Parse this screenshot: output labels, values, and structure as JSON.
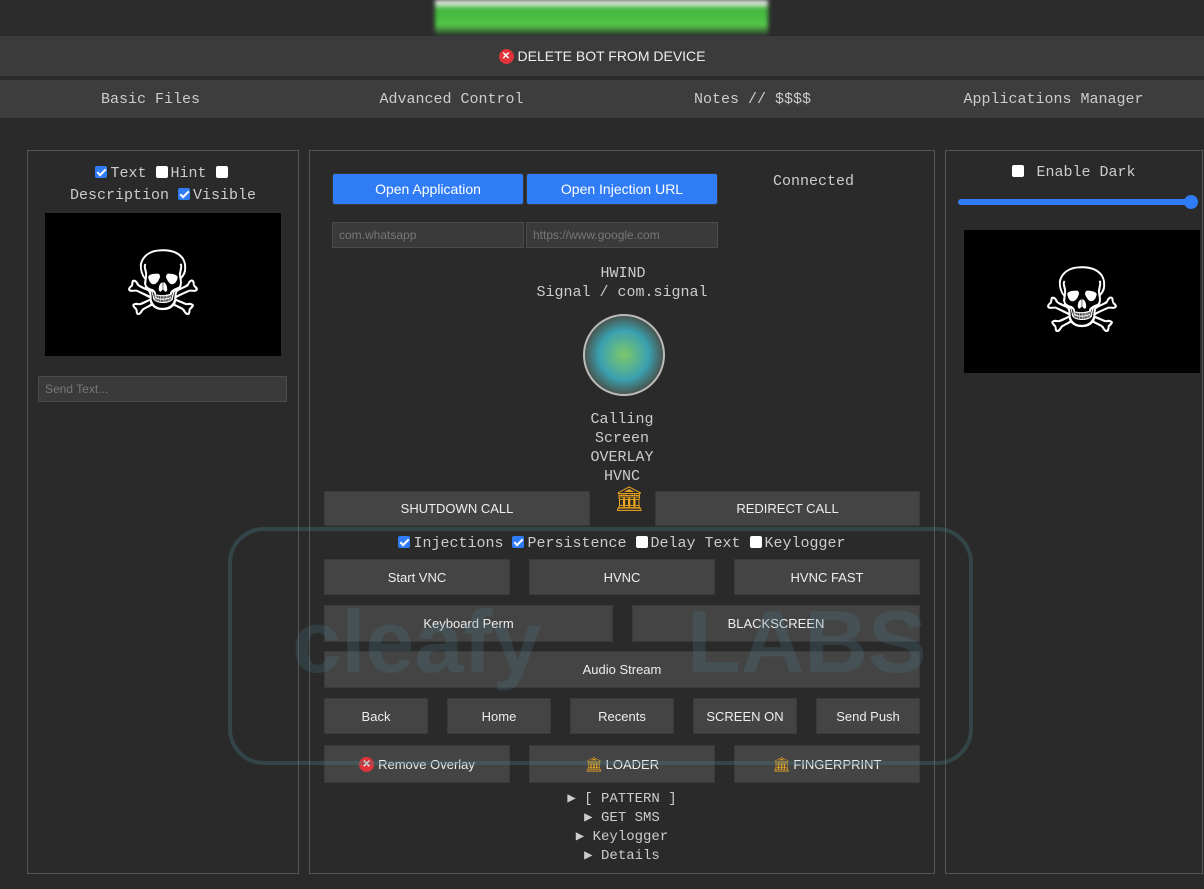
{
  "top": {
    "delete_label": "DELETE BOT FROM DEVICE"
  },
  "tabs": [
    "Basic Files",
    "Advanced Control",
    "Notes // $$$$",
    "Applications Manager"
  ],
  "left": {
    "options": [
      {
        "label": "Text",
        "checked": true
      },
      {
        "label": "Hint",
        "checked": false
      },
      {
        "label": "Description",
        "checked": false
      },
      {
        "label": "Visible",
        "checked": true
      }
    ],
    "send_placeholder": "Send Text..."
  },
  "center": {
    "open_app": "Open Application",
    "open_url": "Open Injection URL",
    "status": "Connected",
    "app_placeholder": "com.whatsapp",
    "url_placeholder": "https://www.google.com",
    "bot_name": "HWIND",
    "app_info": "Signal / com.signal",
    "modes": [
      "Calling",
      "Screen",
      "OVERLAY",
      "HVNC"
    ],
    "shutdown_call": "SHUTDOWN CALL",
    "redirect_call": "REDIRECT CALL",
    "toggles": [
      {
        "label": "Injections",
        "checked": true
      },
      {
        "label": "Persistence",
        "checked": true
      },
      {
        "label": "Delay Text",
        "checked": false
      },
      {
        "label": "Keylogger",
        "checked": false
      }
    ],
    "row1": [
      "Start VNC",
      "HVNC",
      "HVNC FAST"
    ],
    "keyboard_perm": "Keyboard Perm",
    "blackscreen": "BLACKSCREEN",
    "audio_stream": "Audio Stream",
    "nav": [
      "Back",
      "Home",
      "Recents",
      "SCREEN ON",
      "Send Push"
    ],
    "remove_overlay": "Remove Overlay",
    "loader": "LOADER",
    "fingerprint": "FINGERPRINT",
    "details": [
      "[ PATTERN ]",
      "GET SMS",
      "Keylogger",
      "Details"
    ]
  },
  "right": {
    "enable_dark": "Enable Dark",
    "slider_value": 1.0
  },
  "watermark": {
    "left": "cleafy",
    "right": "LABS"
  },
  "colors": {
    "accent": "#2f7cf6",
    "danger": "#e0333a",
    "bank": "#f0a81e"
  }
}
